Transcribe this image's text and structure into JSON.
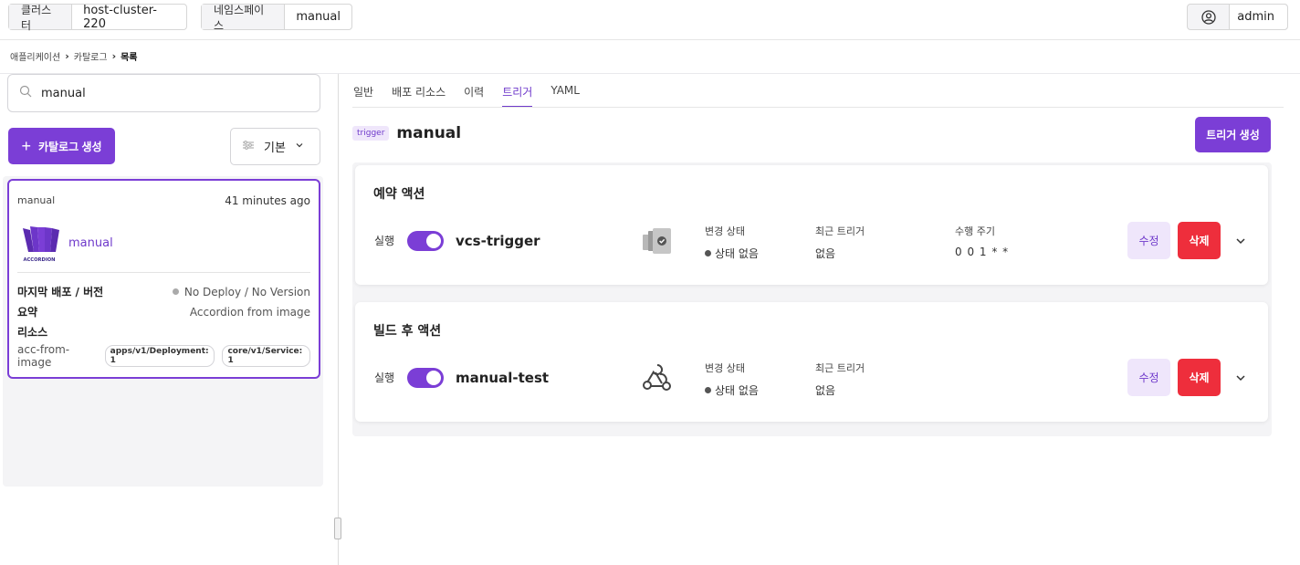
{
  "header": {
    "cluster_label": "클러스터",
    "cluster_value": "host-cluster-220",
    "namespace_label": "네임스페이스",
    "namespace_value": "manual",
    "user": "admin"
  },
  "breadcrumb": [
    "애플리케이션",
    "카탈로그",
    "목록"
  ],
  "left": {
    "search_value": "manual",
    "create_button": "카탈로그 생성",
    "sort_label": "기본",
    "card": {
      "namespace": "manual",
      "time": "41 minutes ago",
      "logo_text": "ACCORDION",
      "name": "manual",
      "last_deploy_label": "마지막 배포 / 버전",
      "last_deploy_value": "No Deploy / No Version",
      "summary_label": "요약",
      "summary_value": "Accordion from image",
      "resource_label": "리소스",
      "resource_name": "acc-from-image",
      "resource_tags": [
        "apps/v1/Deployment: 1",
        "core/v1/Service: 1"
      ]
    }
  },
  "right": {
    "tabs": [
      "일반",
      "배포 리소스",
      "이력",
      "트리거",
      "YAML"
    ],
    "active_tab": "트리거",
    "badge": "trigger",
    "title": "manual",
    "create_trigger": "트리거 생성",
    "sections": [
      {
        "heading": "예약 액션",
        "run_label": "실행",
        "enabled": true,
        "name": "vcs-trigger",
        "icon": "vcs-icon",
        "change_state_label": "변경 상태",
        "change_state_value": "상태 없음",
        "last_trigger_label": "최근 트리거",
        "last_trigger_value": "없음",
        "schedule_label": "수행 주기",
        "schedule_value": "0 0 1 * *",
        "edit": "수정",
        "delete": "삭제"
      },
      {
        "heading": "빌드 후 액션",
        "run_label": "실행",
        "enabled": true,
        "name": "manual-test",
        "icon": "webhook-icon",
        "change_state_label": "변경 상태",
        "change_state_value": "상태 없음",
        "last_trigger_label": "최근 트리거",
        "last_trigger_value": "없음",
        "edit": "수정",
        "delete": "삭제"
      }
    ]
  },
  "colors": {
    "accent": "#7b3ed6",
    "danger": "#ee2e3c",
    "accent_soft": "#efe6fb"
  }
}
